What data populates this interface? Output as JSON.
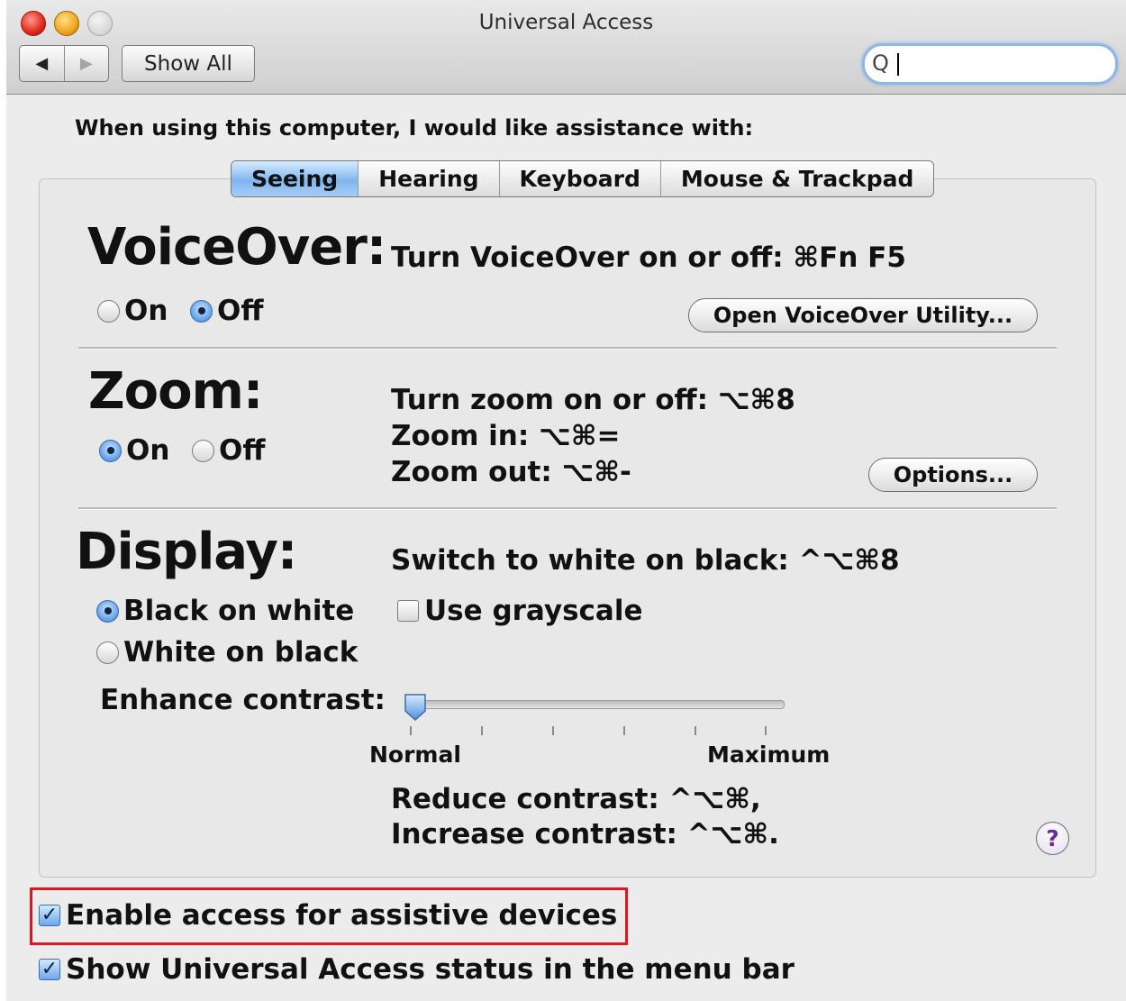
{
  "window": {
    "title": "Universal Access"
  },
  "toolbar": {
    "back_icon": "◀",
    "forward_icon": "▶",
    "show_all": "Show All",
    "search_glass": "Q",
    "search_value": ""
  },
  "prompt": "When using this computer, I would like assistance with:",
  "tabs": [
    {
      "label": "Seeing",
      "active": true
    },
    {
      "label": "Hearing",
      "active": false
    },
    {
      "label": "Keyboard",
      "active": false
    },
    {
      "label": "Mouse & Trackpad",
      "active": false
    }
  ],
  "voiceover": {
    "heading": "VoiceOver:",
    "shortcut": "Turn VoiceOver on or off: ⌘Fn F5",
    "on_label": "On",
    "off_label": "Off",
    "selected": "Off",
    "utility_button": "Open VoiceOver Utility..."
  },
  "zoom": {
    "heading": "Zoom:",
    "shortcut_toggle": "Turn zoom on or off: ⌥⌘8",
    "shortcut_in": "Zoom in: ⌥⌘=",
    "shortcut_out": "Zoom out: ⌥⌘-",
    "on_label": "On",
    "off_label": "Off",
    "selected": "On",
    "options_button": "Options..."
  },
  "display": {
    "heading": "Display:",
    "shortcut": "Switch to white on black: ^⌥⌘8",
    "black_on_white": "Black on white",
    "white_on_black": "White on black",
    "selected": "Black on white",
    "grayscale_label": "Use grayscale",
    "grayscale_checked": false,
    "contrast_label": "Enhance contrast:",
    "contrast_min": "Normal",
    "contrast_max": "Maximum",
    "contrast_value": 0,
    "reduce_contrast": "Reduce contrast: ^⌥⌘,",
    "increase_contrast": "Increase contrast: ^⌥⌘."
  },
  "help_label": "?",
  "footer": {
    "assistive_devices": "Enable access for assistive devices",
    "assistive_checked": true,
    "menu_bar_status": "Show Universal Access status in the menu bar",
    "menu_bar_checked": true,
    "check_mark": "✓"
  },
  "colors": {
    "highlight_box": "#e3141e",
    "active_tab": "#7fb6ef"
  }
}
